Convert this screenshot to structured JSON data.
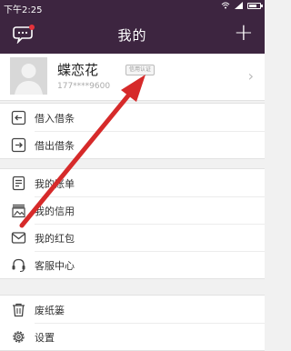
{
  "status_bar": {
    "time": "下午2:25"
  },
  "header": {
    "title": "我的",
    "left_icon": "message-icon",
    "right_icon": "plus-icon"
  },
  "profile": {
    "name": "蝶恋花",
    "badge": "信用认证",
    "phone": "177****9600"
  },
  "groups": [
    {
      "items": [
        {
          "label": "借入借条",
          "icon": "borrow-in-icon"
        },
        {
          "label": "借出借条",
          "icon": "lend-out-icon"
        }
      ]
    },
    {
      "items": [
        {
          "label": "我的账单",
          "icon": "bill-icon"
        },
        {
          "label": "我的信用",
          "icon": "credit-icon"
        },
        {
          "label": "我的红包",
          "icon": "red-packet-icon"
        },
        {
          "label": "客服中心",
          "icon": "headset-icon"
        }
      ]
    },
    {
      "items": [
        {
          "label": "废纸篓",
          "icon": "trash-icon"
        },
        {
          "label": "设置",
          "icon": "gear-icon"
        }
      ]
    }
  ],
  "colors": {
    "header_bg": "#3d2540",
    "annotation_arrow": "#d62a2a"
  }
}
